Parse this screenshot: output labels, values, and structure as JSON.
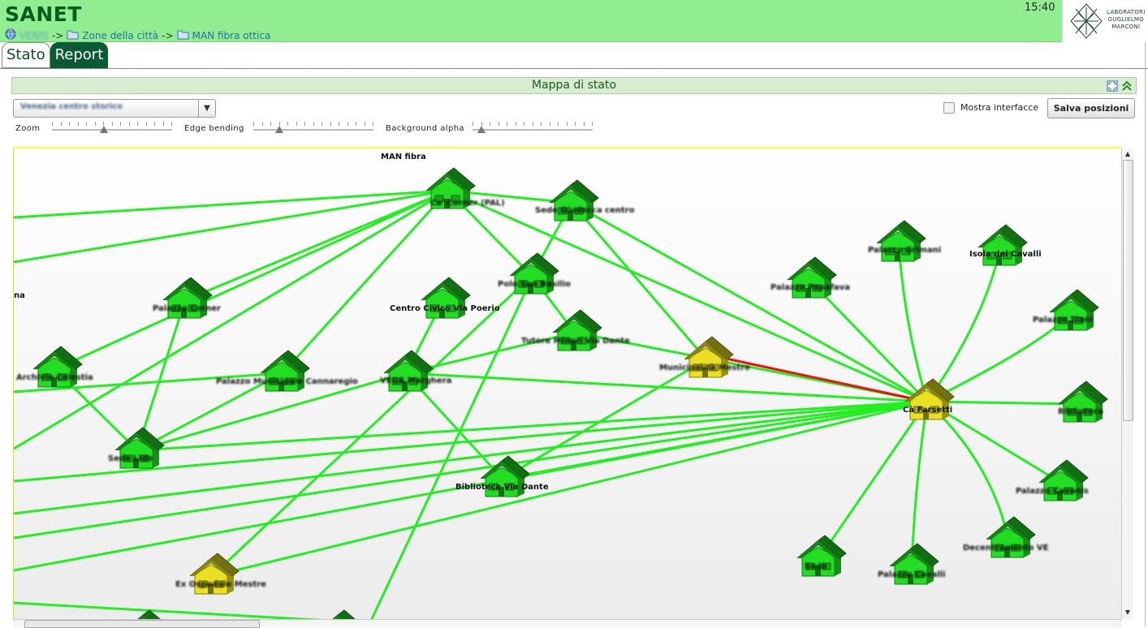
{
  "app": {
    "title": "SANET",
    "clock": "15:40"
  },
  "breadcrumb": {
    "root": "VENIS",
    "sep": "->",
    "items": [
      "Zone della città",
      "MAN fibra ottica"
    ]
  },
  "logo": {
    "line1": "LABORATORI",
    "line2": "GUGLIELMO",
    "line3": "MARCONI"
  },
  "tabs": [
    {
      "label": "Stato"
    },
    {
      "label": "Report"
    }
  ],
  "panel": {
    "title": "Mappa di stato"
  },
  "toolbar": {
    "map_select": "Venezia centro storico",
    "show_interfaces_label": "Mostra interfacce",
    "save_label": "Salva posizioni",
    "zoom_label": "Zoom",
    "edge_label": "Edge bending",
    "alpha_label": "Background alpha"
  },
  "map": {
    "group_label": "MAN fibra",
    "edge_label_left": "na",
    "colors": {
      "ok": "#22dd22",
      "warning": "#e8e020",
      "link_ok": "#22ee22",
      "link_down": "#ee1111"
    },
    "nodes": [
      {
        "id": "hub-top",
        "status": "ok",
        "label": "Ca' Corner (PAL)"
      },
      {
        "id": "n2",
        "status": "ok",
        "label": "Sede Giudecca centro"
      },
      {
        "id": "n3",
        "status": "ok",
        "label": "Palazzo Grimani"
      },
      {
        "id": "n4",
        "status": "ok",
        "label": "Isola dei Cavalli"
      },
      {
        "id": "n5",
        "status": "ok",
        "label": "Palazzo Ziani"
      },
      {
        "id": "n6",
        "status": "ok",
        "label": "Palazzo Papafava"
      },
      {
        "id": "n7",
        "status": "ok",
        "label": "Polo San Basilio"
      },
      {
        "id": "n8",
        "status": "ok",
        "label": "Centro Civico Via Poerio"
      },
      {
        "id": "n9",
        "status": "ok",
        "label": "Palazzo Corner"
      },
      {
        "id": "n10",
        "status": "ok",
        "label": "Tutore Minori Via Dante"
      },
      {
        "id": "n11",
        "status": "warning",
        "label": "Municipalità Mestre"
      },
      {
        "id": "n12",
        "status": "ok",
        "label": "Archivio Celestia"
      },
      {
        "id": "n13",
        "status": "ok",
        "label": "Palazzo Municipale Cannaregio"
      },
      {
        "id": "n14",
        "status": "ok",
        "label": "VEGA Marghera"
      },
      {
        "id": "ca-farsetti",
        "status": "warning",
        "label": "Cà Farsetti"
      },
      {
        "id": "n16",
        "status": "ok",
        "label": "Biblioteca"
      },
      {
        "id": "n17",
        "status": "ok",
        "label": "Sede Lido"
      },
      {
        "id": "n18",
        "status": "ok",
        "label": "Biblioteca Via Dante"
      },
      {
        "id": "n19",
        "status": "ok",
        "label": "Palazzo Cavanis"
      },
      {
        "id": "n20",
        "status": "ok",
        "label": "Decentramento VE"
      },
      {
        "id": "n21",
        "status": "warning",
        "label": "Ex Ospedale Mestre"
      },
      {
        "id": "n22",
        "status": "ok",
        "label": "Sede"
      },
      {
        "id": "n23",
        "status": "ok",
        "label": "Palazzo Cavalli"
      }
    ]
  }
}
